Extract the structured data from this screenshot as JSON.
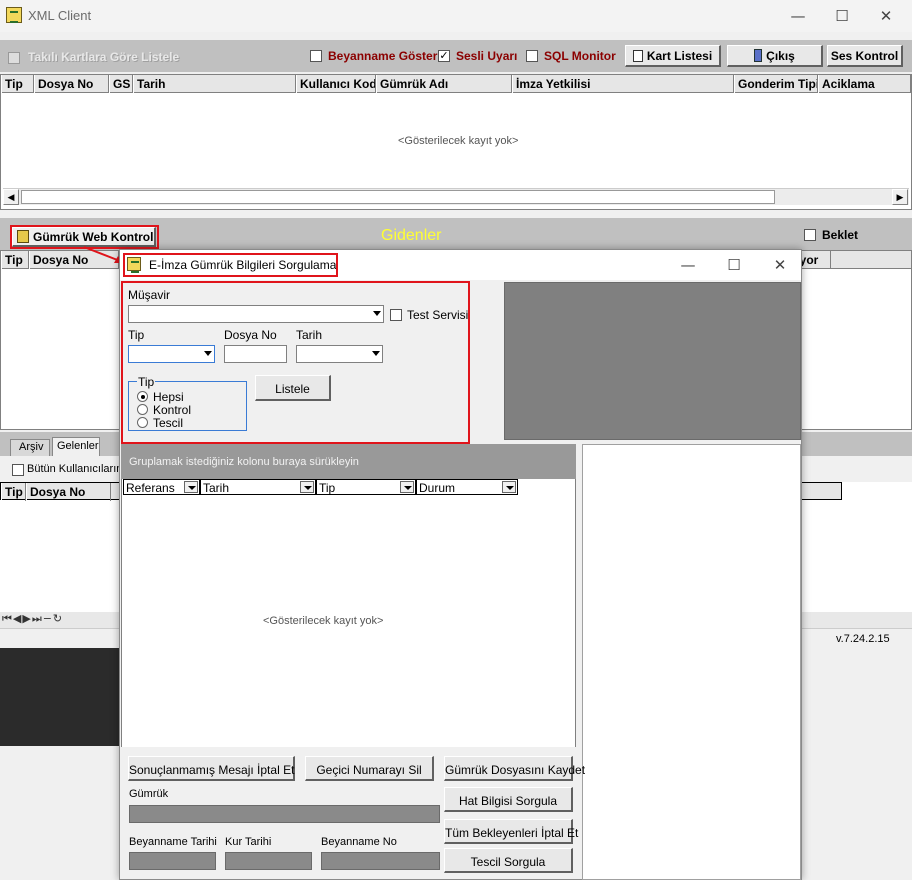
{
  "window": {
    "title": "XML Client",
    "controls": [
      "—",
      "☐",
      "✕"
    ]
  },
  "top_toolbar": {
    "takili_label": "Takılı Kartlara Göre Listele",
    "beyanname_goster": "Beyanname Göster",
    "sesli_uyari": "Sesli Uyarı",
    "sql_monitor": "SQL Monitor",
    "kart_listesi": "Kart Listesi",
    "cikis": "Çıkış",
    "ses_kontrol": "Ses Kontrol"
  },
  "top_grid": {
    "columns": [
      "Tip",
      "Dosya No",
      "GS",
      "Tarih",
      "Kullanıcı Kodu",
      "Gümrük Adı",
      "İmza Yetkilisi",
      "Gonderim Tipi",
      "Aciklama"
    ],
    "empty": "<Gösterilecek kayıt yok>"
  },
  "gidenler": {
    "gumruk_web_kontrol": "Gümrük Web Kontrol",
    "title": "Gidenler",
    "beklet": "Beklet",
    "columns": [
      "Tip",
      "Dosya No"
    ],
    "partial_col": "niyor"
  },
  "lower": {
    "tabs": [
      "Arşiv",
      "Gelenler"
    ],
    "butun_kullanicilar": "Bütün Kullanıcıların",
    "columns": [
      "Tip",
      "Dosya No"
    ],
    "version": "v.7.24.2.15"
  },
  "dialog": {
    "title": "E-İmza Gümrük Bilgileri Sorgulama",
    "controls": [
      "—",
      "☐",
      "✕"
    ],
    "musavir_label": "Müşavir",
    "test_servisi": "Test Servisi",
    "tip_label": "Tip",
    "dosya_no_label": "Dosya No",
    "tarih_label": "Tarih",
    "tip_group_label": "Tip",
    "radio_options": [
      "Hepsi",
      "Kontrol",
      "Tescil"
    ],
    "listele": "Listele",
    "group_panel": "Gruplamak istediğiniz kolonu buraya sürükleyin",
    "grid_columns": [
      "Referans",
      "Tarih",
      "Tip",
      "Durum"
    ],
    "empty": "<Gösterilecek kayıt yok>",
    "btn_sonuclanmamis": "Sonuçlanmamış Mesajı İptal Et",
    "btn_gecici": "Geçici Numarayı Sil",
    "btn_gumruk_dosyasi": "Gümrük Dosyasını Kaydet",
    "btn_hat_bilgisi": "Hat Bilgisi Sorgula",
    "btn_tum_bekleyenler": "Tüm Bekleyenleri İptal Et",
    "btn_tescil": "Tescil Sorgula",
    "gumruk_label": "Gümrük",
    "beyanname_tarihi": "Beyanname Tarihi",
    "kur_tarihi": "Kur Tarihi",
    "beyanname_no": "Beyanname No"
  }
}
